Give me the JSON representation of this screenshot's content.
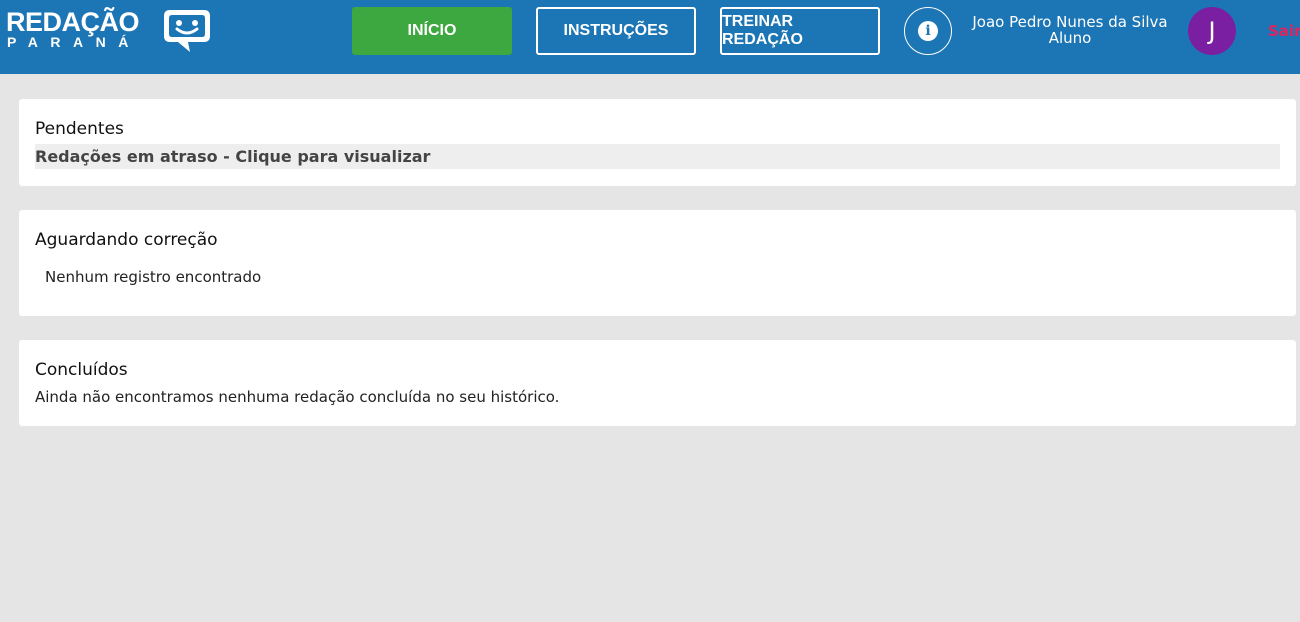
{
  "header": {
    "logo_title": "REDAÇÃO",
    "logo_subtitle": "PARANÁ",
    "nav": {
      "inicio": "INÍCIO",
      "instrucoes": "INSTRUÇÕES",
      "treinar": "TREINAR REDAÇÃO"
    },
    "info_icon": "info-icon",
    "user": {
      "name": "Joao Pedro Nunes da Silva",
      "role": "Aluno",
      "initial": "J"
    },
    "logout": "Sair",
    "colors": {
      "bar": "#1c75b4",
      "active_nav": "#3ca83f",
      "avatar": "#7b1fa2",
      "logout": "#e0245e"
    }
  },
  "sections": {
    "pendentes": {
      "title": "Pendentes",
      "link": "Redações em atraso - Clique para visualizar"
    },
    "aguardando": {
      "title": "Aguardando correção",
      "empty": "Nenhum registro encontrado"
    },
    "concluidos": {
      "title": "Concluídos",
      "empty": "Ainda não encontramos nenhuma redação concluída no seu histórico."
    }
  }
}
